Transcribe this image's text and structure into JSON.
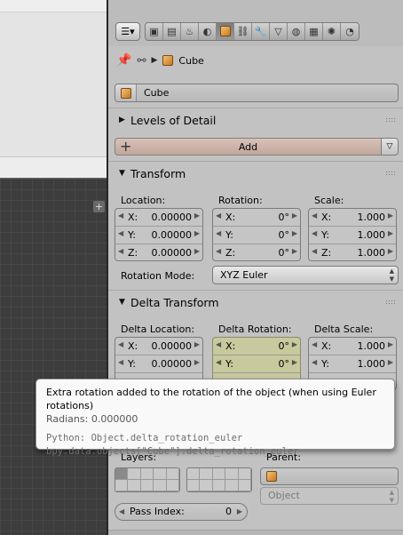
{
  "object_name": "Cube",
  "breadcrumb": {
    "object": "Cube"
  },
  "context_tabs": [
    "render-icon",
    "render-layers-icon",
    "scene-icon",
    "world-icon",
    "object-icon",
    "constraints-icon",
    "modifiers-icon",
    "material-icon",
    "texture-icon",
    "particles-icon",
    "physics-icon"
  ],
  "sections": {
    "lod": {
      "title": "Levels of Detail",
      "add_label": "Add"
    },
    "transform": {
      "title": "Transform",
      "location": {
        "label": "Location:",
        "x": "0.00000",
        "y": "0.00000",
        "z": "0.00000"
      },
      "rotation": {
        "label": "Rotation:",
        "x": "0°",
        "y": "0°",
        "z": "0°"
      },
      "scale": {
        "label": "Scale:",
        "x": "1.000",
        "y": "1.000",
        "z": "1.000"
      },
      "rotation_mode_label": "Rotation Mode:",
      "rotation_mode_value": "XYZ Euler"
    },
    "delta": {
      "title": "Delta Transform",
      "location": {
        "label": "Delta Location:",
        "x": "0.00000",
        "y": "0.00000"
      },
      "rotation": {
        "label": "Delta Rotation:",
        "x": "0°",
        "y": "0°"
      },
      "scale": {
        "label": "Delta Scale:",
        "x": "1.000",
        "y": "1.000"
      }
    },
    "relations": {
      "layers_label": "Layers:",
      "parent_label": "Parent:",
      "parent_type": "Object",
      "pass_index_label": "Pass Index:",
      "pass_index_value": "0"
    }
  },
  "axis": {
    "x": "X:",
    "y": "Y:",
    "z": "Z:"
  },
  "tooltip": {
    "description": "Extra rotation added to the rotation of the object (when using Euler rotations)",
    "unit": "Radians: 0.000000",
    "python_1": "Python: Object.delta_rotation_euler",
    "python_2": "bpy.data.objects[\"Cube\"].delta_rotation_euler"
  },
  "colors": {
    "highlight_field": "#c9c99e",
    "lod_add_button": "#d8c2b8",
    "panel_bg": "#c2c2c2",
    "tooltip_bg": "#f9f9f9"
  }
}
